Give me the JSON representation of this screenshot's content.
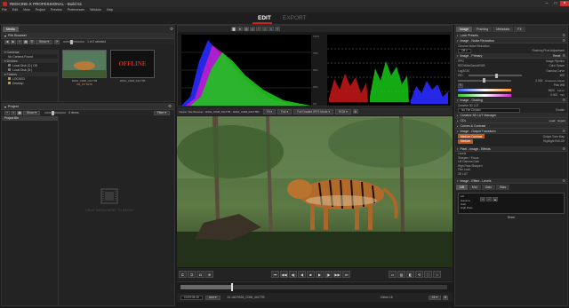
{
  "app": {
    "title": "REDCINE-X PROFESSIONAL - Build 51"
  },
  "menu": [
    "File",
    "Edit",
    "View",
    "Project",
    "Preview",
    "Preferences",
    "Window",
    "Help"
  ],
  "modes": {
    "edit": "EDIT",
    "export": "EXPORT"
  },
  "media": {
    "tab": "Media",
    "file_browser_title": "File Browser",
    "show_label": "Show",
    "selection_count": "1 of 2 selected",
    "tree": {
      "cameras_header": "Cameras",
      "no_camera": "No Camera Found",
      "devices_header": "Devices",
      "devices": [
        "Local Disk (C:) OS",
        "Local Disk (D:)"
      ],
      "folders_header": "Folders",
      "folders": [
        "LOCKED",
        "Desktop"
      ]
    },
    "thumbnails": [
      {
        "caption": "R001_C008_0417TB",
        "sub": "FR_FP  TE78"
      },
      {
        "caption": "R002_C008_0417TB",
        "offline_label": "OFFLINE"
      }
    ]
  },
  "project": {
    "title": "Project",
    "show_label": "Show",
    "items_label": "0 items",
    "filter_label": "Filter",
    "bin_name": "Project Bin",
    "drop_hint": "DRAG MEDIA HERE TO BEGIN"
  },
  "scopes": {
    "histogram_title": "Histogram",
    "waveform_title": "RGB Parade",
    "histogram_scale": [
      "100%",
      "75%",
      "50%",
      "25%",
      "0%"
    ],
    "waveform_scale": [
      "100%",
      "80%",
      "60%",
      "40%",
      "20%",
      "0%"
    ]
  },
  "viewer": {
    "source_label": "Viewer: File Browser - R002_C008_0417TB - R002_C008_0417TB1",
    "fit_label": "Fit",
    "quality_label": "Full",
    "debayer_label": "Full Graded IPP2 Mode",
    "aspect_label": "RGB",
    "timecode_in": "10:29:34:16",
    "audio_label": "Aud",
    "timecode_clip": "24 182 R002_C008_0417TB",
    "zoom_label": "10mm 16",
    "fps_label": "24"
  },
  "image_panel": {
    "tabs": [
      "Image",
      "Framing",
      "Metadata",
      "FX"
    ],
    "looks_header": "Look Presets",
    "noise_header": "Image - Noise Reduction",
    "noise_row": "Chroma Noise Reduction",
    "noise_value": "Off",
    "noise_toggle": "Flashing Pixel Adjustment",
    "primary_header": "Image - Primary",
    "reset_label": "Reset",
    "primary_rows": [
      {
        "label": "IPP2",
        "value": "Image Pipeline"
      },
      {
        "label": "REDWideGamutRGB",
        "value": "Color Space"
      },
      {
        "label": "Log3G10",
        "value": "Gamma Curve"
      },
      {
        "label": "ISO",
        "value": "800"
      },
      {
        "label": "Exposure Adjust",
        "value": "0.000"
      },
      {
        "label": "Kelvin",
        "value": "5600"
      },
      {
        "label": "Tint",
        "value": "0.000"
      }
    ],
    "preset_label": "Pink WB",
    "grading_header": "Image - Grading",
    "lut_header": "Creative 3D LUT",
    "lut_value": "No File Chosen",
    "lut_enable": "Enable",
    "lut_manager": "Creative 3D LUT Manager",
    "cdl_header": "CDL",
    "cdl_load": "Load",
    "cdl_export": "Export",
    "curves_header": "Curves & Contrast",
    "output_header": "Image - Output Transform",
    "output_rows": [
      {
        "label": "Medium Contrast",
        "value": "Output Tone Map"
      },
      {
        "label": "Medium",
        "value": "Highlight Roll-Off"
      }
    ],
    "pixel_header": "Pixel - Image - Effects",
    "pixel_items": [
      "Levels",
      "Sharpen / Focus",
      "Lift Gamma Gain",
      "High Pass Sharpen",
      "Film Look",
      "3D LUT"
    ],
    "image_effects_header": "Image - Effect - Levels",
    "effect_tabs": [
      "Lift",
      "Mid",
      "Gain",
      "Bias"
    ],
    "effect_list": [
      "Lift",
      "Gamma",
      "Gain",
      "High Pass",
      "Film Look"
    ],
    "effect_reset": "Reset"
  },
  "colors": {
    "accent": "#c82020",
    "orange": "#c0561e",
    "panel": "#232323"
  }
}
